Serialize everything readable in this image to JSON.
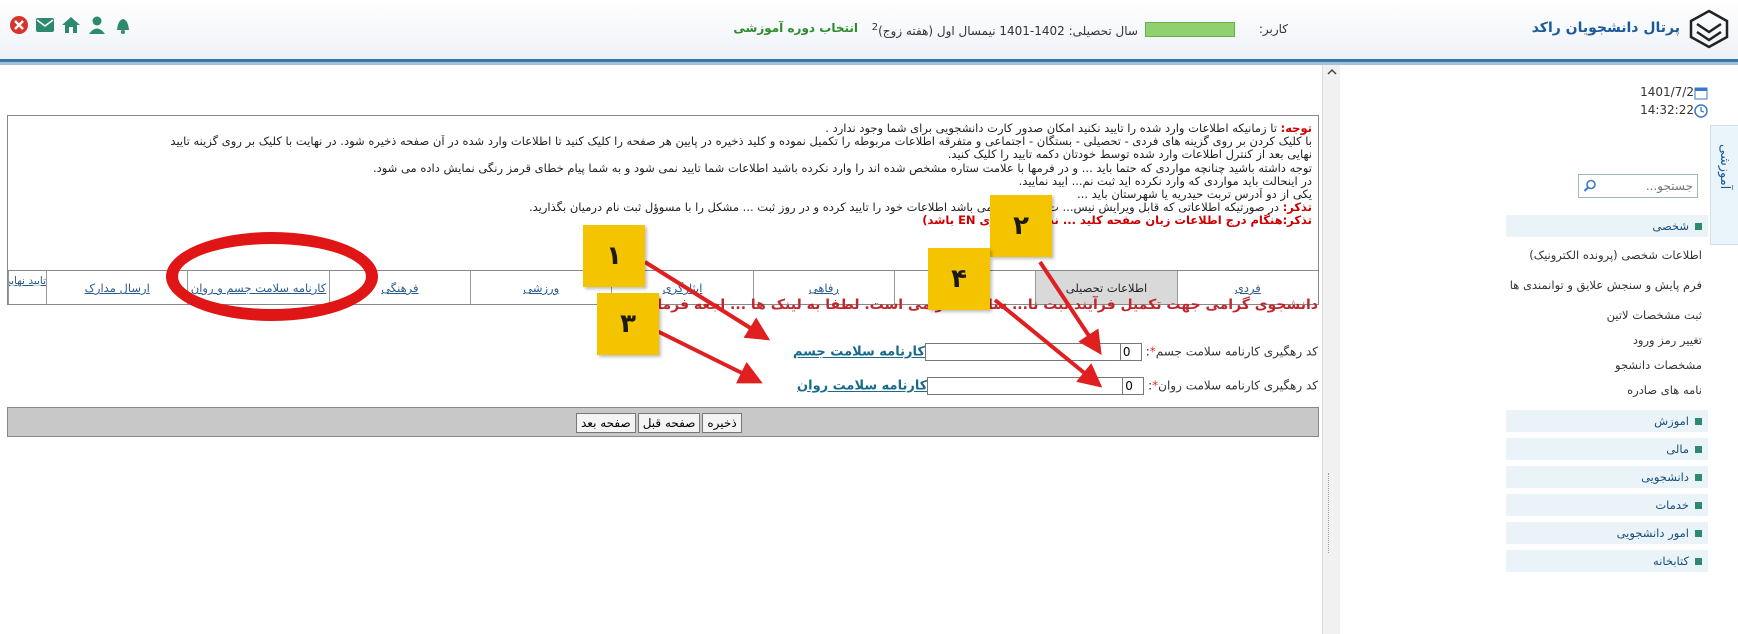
{
  "header": {
    "portal_title": "پرتال دانشجویان راکد",
    "user_label": "کاربر:",
    "academic_year": "سال تحصیلی: 1402-1401 نیمسال اول (هفته زوج)",
    "week_superscript": "2",
    "term_title": "انتخاب دوره آموزشی",
    "icons": [
      "close-icon",
      "mail-icon",
      "home-icon",
      "user-icon",
      "bell-icon"
    ]
  },
  "sidebar": {
    "date": "1401/7/2",
    "time": "14:32:22",
    "search_placeholder": "جستجو...",
    "side_tab": "آموزشی",
    "items": [
      {
        "label": "شخصی",
        "type": "head"
      },
      {
        "label": "اطلاعات شخصی (پرونده الکترونیک)",
        "type": "link"
      },
      {
        "label": "فرم پایش و سنجش علایق و توانمندی ها",
        "type": "link"
      },
      {
        "label": "ثبت مشخصات لاتین",
        "type": "link"
      },
      {
        "label": "تغییر رمز ورود",
        "type": "link"
      },
      {
        "label": "مشخصات دانشجو",
        "type": "link"
      },
      {
        "label": "نامه های صادره",
        "type": "link"
      },
      {
        "label": "اموزش",
        "type": "head"
      },
      {
        "label": "مالی",
        "type": "head"
      },
      {
        "label": "دانشجویی",
        "type": "head"
      },
      {
        "label": "خدمات",
        "type": "head"
      },
      {
        "label": "امور دانشجویی",
        "type": "head"
      },
      {
        "label": "کتابخانه",
        "type": "head"
      }
    ]
  },
  "notice": {
    "attention_label": "توجه:",
    "lines": [
      " تا زمانیکه اطلاعات وارد شده را تایید نکنید امکان صدور کارت دانشجویی برای شما وجود ندارد .",
      "با کلیک کردن بر روی گزینه های فردی - تحصیلی - بستگان - اجتماعی و متفرقه اطلاعات مربوطه را تکمیل نموده و کلید ذخیره در پایین هر صفحه را کلیک کنید تا اطلاعات وارد شده در آن صفحه ذخیره شود. در نهایت با کلیک بر روی گزینه تایید",
      "نهایی بعد از کنترل اطلاعات وارد شده توسط خودتان دکمه تایید را کلیک کنید.",
      "توجه داشته باشید چنانچه مواردی که حتما باید ... و در فرمها با علامت ستاره مشخص شده اند را وارد نکرده باشید اطلاعات شما تایید نمی شود و به شما پیام خطای قرمز رنگی نمایش داده می شود.",
      "در اینحالت باید مواردی که وارد نکرده اید ثبت نم... ایید نمایید.",
      "یکی از دو آدرس تربت حیدریه یا شهرستان باید ..."
    ],
    "reminder_label": "تذکر:",
    "reminder_text": " در صورتیکه اطلاعاتی که قابل ویرایش نیس... ت شما مغایر می باشد اطلاعات خود را تایید کرده و در روز ثبت ... مشکل را با مسوؤل ثبت نام درمیان بگذارید.",
    "reminder2": "تذکر:هنگام درج اطلاعات زبان صفحه کلید ... ندهید (بر روی EN باشد)"
  },
  "tabs": [
    {
      "label": "فردی",
      "active": false
    },
    {
      "label": "اطلاعات تحصیلی",
      "active": true
    },
    {
      "label": "خانوادگی",
      "active": false
    },
    {
      "label": "رفاهی",
      "active": false
    },
    {
      "label": "ایثارگری",
      "active": false
    },
    {
      "label": "ورزشی",
      "active": false
    },
    {
      "label": "فرهنگی",
      "active": false
    },
    {
      "label": "کارنامه سلامت جسم و روان",
      "active": false
    },
    {
      "label": "ارسال مدارک",
      "active": false
    },
    {
      "label": "تایید نهایی",
      "active": false
    }
  ],
  "health": {
    "alert": "دانشجوی گرامی جهت تکمیل فرآیند ثبت نا... سلامت الزامی است. لطفا به لینک ها ... اجعه فرمایید.",
    "body_code_label": "کد رهگیری کارنامه سلامت جسم",
    "body_code_value": "0",
    "body_link": "کارنامه سلامت جسم",
    "mind_code_label": "کد رهگیری کارنامه سلامت روان",
    "mind_code_value": "0",
    "mind_link": "کارنامه سلامت روان"
  },
  "buttons": {
    "save": "ذخیره",
    "prev": "صفحه قبل",
    "next": "صفحه بعد"
  },
  "annotations": {
    "badges": [
      "۱",
      "۲",
      "۳",
      "۴"
    ],
    "badge_color": "#f5c400",
    "arrow_color": "#e02020",
    "ring_color": "#e01515"
  }
}
